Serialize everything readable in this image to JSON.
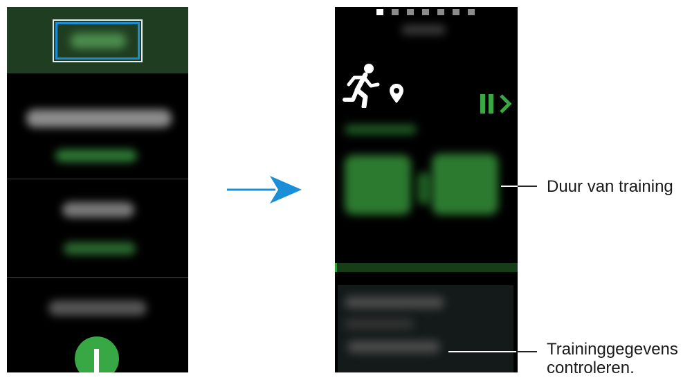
{
  "callouts": {
    "duration": "Duur van training",
    "details_line1": "Traininggegevens",
    "details_line2": "controleren."
  },
  "colors": {
    "accent_green": "#37a843",
    "dark_green": "#1f3d21",
    "arrow_blue": "#1a8fd8"
  },
  "icons": {
    "start": "start-icon",
    "runner": "running-icon",
    "location": "location-pin-icon",
    "pause": "pause-icon",
    "next": "chevron-right-icon"
  }
}
